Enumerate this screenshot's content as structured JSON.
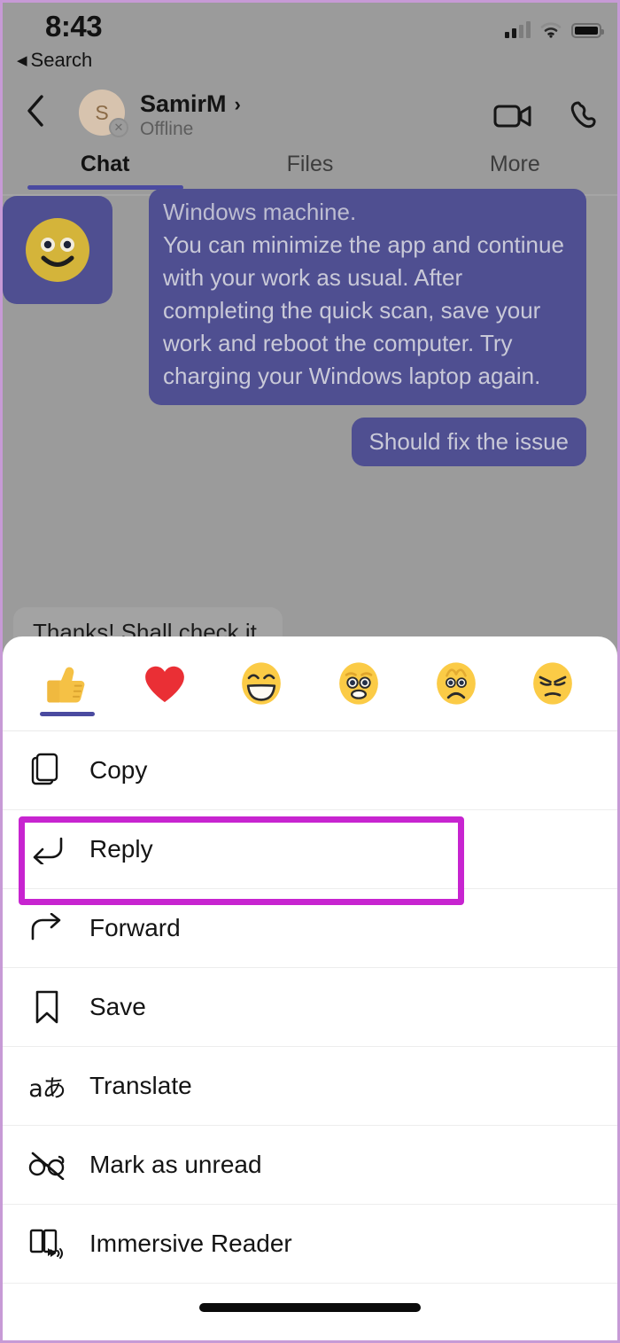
{
  "status_bar": {
    "time": "8:43",
    "signal_icon": "cellular-signal-icon",
    "signal_bars_filled": 2,
    "wifi_icon": "wifi-icon",
    "battery_icon": "battery-icon"
  },
  "back_to_app": {
    "label": "Search",
    "icon": "back-triangle-icon"
  },
  "nav": {
    "back_icon": "chevron-left-icon",
    "avatar_initial": "S",
    "presence_icon": "offline-x-icon",
    "peer_name": "SamirM",
    "peer_name_chevron": "chevron-right-icon",
    "peer_status": "Offline",
    "video_call_icon": "video-camera-icon",
    "audio_call_icon": "phone-icon"
  },
  "tabs": [
    {
      "label": "Chat",
      "active": true
    },
    {
      "label": "Files",
      "active": false
    },
    {
      "label": "More",
      "active": false
    }
  ],
  "messages": [
    {
      "id": "msg-long-outgoing",
      "direction": "outgoing",
      "clipped_first_line": "Windows machine.",
      "text": "You can minimize the app and continue with your work as usual. After completing the quick scan, save your work and reboot the computer. Try charging your Windows laptop again."
    },
    {
      "id": "msg-should-fix",
      "direction": "outgoing",
      "text": "Should fix the issue"
    },
    {
      "id": "msg-emoji-sticker",
      "direction": "outgoing",
      "text": "",
      "sticker": "smiling-face-emoji"
    },
    {
      "id": "msg-thanks",
      "direction": "incoming",
      "text": "Thanks! Shall check it."
    }
  ],
  "sheet": {
    "reactions": [
      {
        "name": "thumbs-up-emoji",
        "label": "Like",
        "selected": true
      },
      {
        "name": "heart-emoji",
        "label": "Heart",
        "selected": false
      },
      {
        "name": "laugh-emoji",
        "label": "Laugh",
        "selected": false
      },
      {
        "name": "surprised-emoji",
        "label": "Surprised",
        "selected": false
      },
      {
        "name": "sad-emoji",
        "label": "Sad",
        "selected": false
      },
      {
        "name": "angry-emoji",
        "label": "Angry",
        "selected": false
      }
    ],
    "menu_items": [
      {
        "label": "Copy",
        "icon": "copy-icon"
      },
      {
        "label": "Reply",
        "icon": "reply-arrow-icon",
        "highlighted": true
      },
      {
        "label": "Forward",
        "icon": "forward-arrow-icon"
      },
      {
        "label": "Save",
        "icon": "bookmark-icon"
      },
      {
        "label": "Translate",
        "icon": "translate-icon",
        "icon_text": "aあ"
      },
      {
        "label": "Mark as unread",
        "icon": "glasses-slash-icon"
      },
      {
        "label": "Immersive Reader",
        "icon": "immersive-reader-icon"
      }
    ],
    "home_indicator": "home-indicator-bar"
  },
  "annotation": {
    "target": "Reply",
    "color": "#c724d0"
  },
  "colors": {
    "outgoing_bubble": "#4f4f91",
    "incoming_bubble": "#a3a3a3",
    "accent": "#4a4aa0",
    "dim_overlay": "#9b9b9b",
    "annotation": "#c724d0",
    "sheet_background": "#ffffff"
  }
}
